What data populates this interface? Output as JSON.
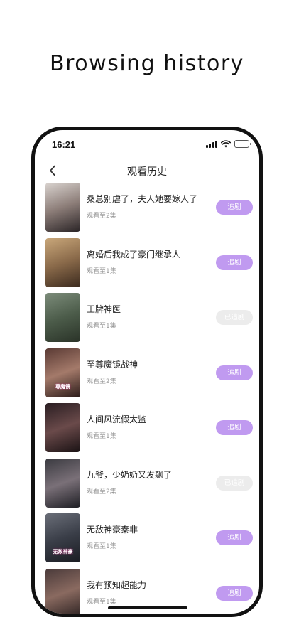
{
  "headline": "Browsing history",
  "status": {
    "time": "16:21"
  },
  "nav": {
    "title": "观看历史"
  },
  "colors": {
    "accent": "#c09af0",
    "followed": "#ececec"
  },
  "history": [
    {
      "title": "桑总别虐了，夫人她要嫁人了",
      "progress": "观看至2集",
      "button": "追剧",
      "followed": false,
      "cover_text": "",
      "cover_colors": [
        "#d9d3cf",
        "#8c7d78",
        "#2a2426"
      ]
    },
    {
      "title": "离婚后我成了豪门继承人",
      "progress": "观看至1集",
      "button": "追剧",
      "followed": false,
      "cover_text": "",
      "cover_colors": [
        "#c9a77a",
        "#8a6a4a",
        "#3b2a1e"
      ]
    },
    {
      "title": "王牌神医",
      "progress": "观看至1集",
      "button": "已追剧",
      "followed": true,
      "cover_text": "",
      "cover_colors": [
        "#7c8c7a",
        "#4c5c4a",
        "#2a3328"
      ]
    },
    {
      "title": "至尊魔镜战神",
      "progress": "观看至2集",
      "button": "追剧",
      "followed": false,
      "cover_text": "尊魔镜",
      "cover_colors": [
        "#5a3a34",
        "#a47a6a",
        "#2a1a18"
      ]
    },
    {
      "title": "人间风流假太监",
      "progress": "观看至1集",
      "button": "追剧",
      "followed": false,
      "cover_text": "",
      "cover_colors": [
        "#2a1e22",
        "#6a4a4a",
        "#1a1214"
      ]
    },
    {
      "title": "九爷，少奶奶又发飙了",
      "progress": "观看至2集",
      "button": "已追剧",
      "followed": true,
      "cover_text": "",
      "cover_colors": [
        "#3a3a40",
        "#7a7078",
        "#1e1e24"
      ]
    },
    {
      "title": "无敌神豪秦非",
      "progress": "观看至1集",
      "button": "追剧",
      "followed": false,
      "cover_text": "无敌神豪",
      "cover_colors": [
        "#6a6e78",
        "#3a3e48",
        "#1a1c22"
      ]
    },
    {
      "title": "我有预知超能力",
      "progress": "观看至1集",
      "button": "追剧",
      "followed": false,
      "cover_text": "",
      "cover_colors": [
        "#4a3a3a",
        "#8a6a60",
        "#2a2020"
      ]
    }
  ]
}
